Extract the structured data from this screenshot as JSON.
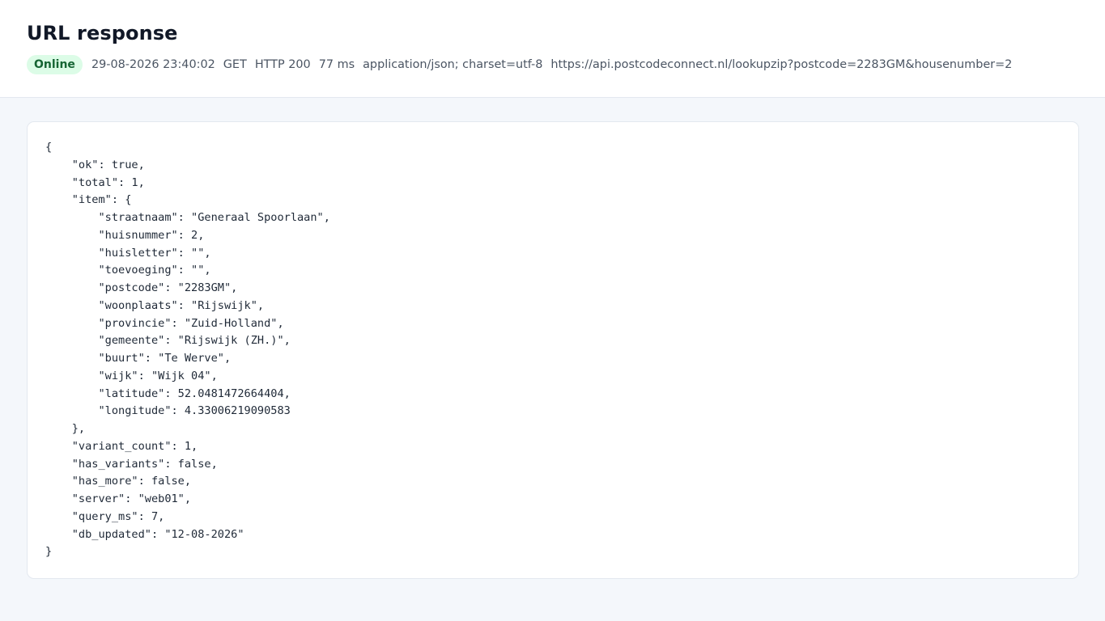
{
  "header": {
    "title": "URL response",
    "status_badge": "Online",
    "timestamp": "29-08-2026 23:40:02",
    "method": "GET",
    "http_status": "HTTP 200",
    "duration": "77 ms",
    "content_type": "application/json; charset=utf-8",
    "url": "https://api.postcodeconnect.nl/lookupzip?postcode=2283GM&housenumber=2"
  },
  "colors": {
    "badge_background": "#dcfce7",
    "badge_text": "#166534"
  },
  "response": {
    "body": "{\n    \"ok\": true,\n    \"total\": 1,\n    \"item\": {\n        \"straatnaam\": \"Generaal Spoorlaan\",\n        \"huisnummer\": 2,\n        \"huisletter\": \"\",\n        \"toevoeging\": \"\",\n        \"postcode\": \"2283GM\",\n        \"woonplaats\": \"Rijswijk\",\n        \"provincie\": \"Zuid-Holland\",\n        \"gemeente\": \"Rijswijk (ZH.)\",\n        \"buurt\": \"Te Werve\",\n        \"wijk\": \"Wijk 04\",\n        \"latitude\": 52.0481472664404,\n        \"longitude\": 4.33006219090583\n    },\n    \"variant_count\": 1,\n    \"has_variants\": false,\n    \"has_more\": false,\n    \"server\": \"web01\",\n    \"query_ms\": 7,\n    \"db_updated\": \"12-08-2026\"\n}"
  }
}
